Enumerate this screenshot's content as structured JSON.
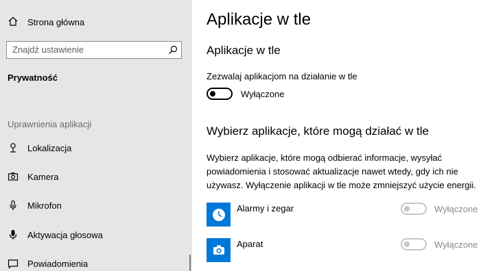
{
  "sidebar": {
    "home": {
      "label": "Strona główna",
      "icon": "home-icon"
    },
    "search": {
      "placeholder": "Znajdź ustawienie",
      "icon": "search-icon"
    },
    "category": "Prywatność",
    "section_header": "Uprawnienia aplikacji",
    "items": [
      {
        "label": "Lokalizacja",
        "icon": "location-pin-icon"
      },
      {
        "label": "Kamera",
        "icon": "camera-icon"
      },
      {
        "label": "Mikrofon",
        "icon": "microphone-icon"
      },
      {
        "label": "Aktywacja głosowa",
        "icon": "voice-activation-icon"
      },
      {
        "label": "Powiadomienia",
        "icon": "notifications-icon"
      }
    ]
  },
  "main": {
    "page_title": "Aplikacje w tle",
    "section1": {
      "title": "Aplikacje w tle",
      "toggle_caption": "Zezwalaj aplikacjom na działanie w tle",
      "toggle_state": "Wyłączone",
      "toggle_on": false
    },
    "section2": {
      "title": "Wybierz aplikacje, które mogą działać w tle",
      "description": "Wybierz aplikacje, które mogą odbierać informacje, wysyłać powiadomienia i stosować aktualizacje nawet wtedy, gdy ich nie używasz. Wyłączenie aplikacji w tle może zmniejszyć użycie energii."
    },
    "apps": [
      {
        "name": "Alarmy i zegar",
        "state": "Wyłączone",
        "icon": "alarm-clock-icon",
        "enabled": false
      },
      {
        "name": "Aparat",
        "state": "Wyłączone",
        "icon": "camera-app-icon",
        "enabled": false
      }
    ]
  },
  "colors": {
    "accent": "#0078d7",
    "sidebar_bg": "#e6e6e6",
    "disabled": "#c6c6c6",
    "disabled_text": "#8a8a8a"
  }
}
